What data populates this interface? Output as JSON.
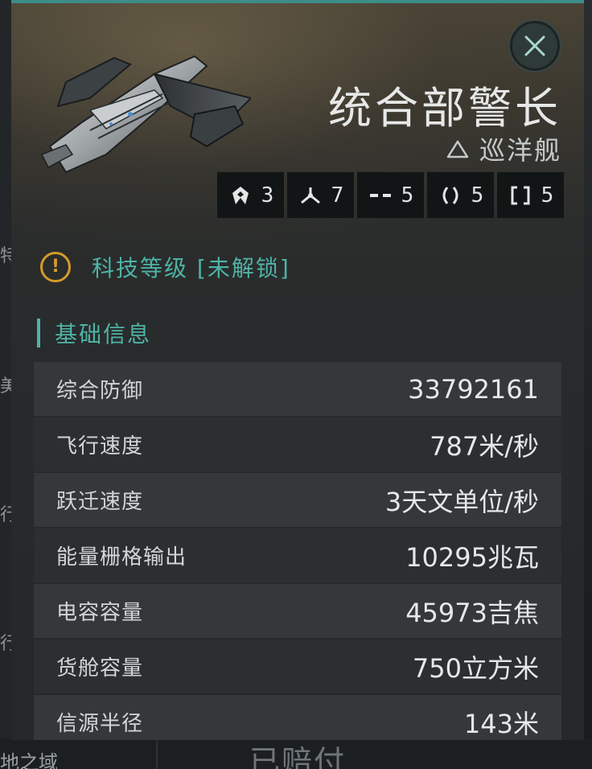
{
  "ship": {
    "name": "统合部警长",
    "class_label": "巡洋舰",
    "class_icon": "house-outline-icon"
  },
  "slots": [
    {
      "icon": "drone-icon",
      "count": "3"
    },
    {
      "icon": "turret-icon",
      "count": "7"
    },
    {
      "icon": "dash-icon",
      "count": "5"
    },
    {
      "icon": "bracket-round-icon",
      "count": "5"
    },
    {
      "icon": "bracket-square-icon",
      "count": "5"
    }
  ],
  "tech": {
    "label": "科技等级 [未解锁]",
    "icon": "warning-icon"
  },
  "section": {
    "title": "基础信息"
  },
  "stats": [
    {
      "label": "综合防御",
      "value": "33792161"
    },
    {
      "label": "飞行速度",
      "value": "787米/秒"
    },
    {
      "label": "跃迁速度",
      "value": "3天文单位/秒"
    },
    {
      "label": "能量栅格输出",
      "value": "10295兆瓦"
    },
    {
      "label": "电容容量",
      "value": "45973吉焦"
    },
    {
      "label": "货舱容量",
      "value": "750立方米"
    },
    {
      "label": "信源半径",
      "value": "143米"
    }
  ],
  "background": {
    "left_texts": [
      "特",
      "美",
      "行",
      "行"
    ],
    "bottom_left": "地之域",
    "bottom_center": "已赔付"
  },
  "colors": {
    "accent": "#4fb3a6",
    "warning": "#d69b2a",
    "top_bar": "#3d8c87"
  }
}
